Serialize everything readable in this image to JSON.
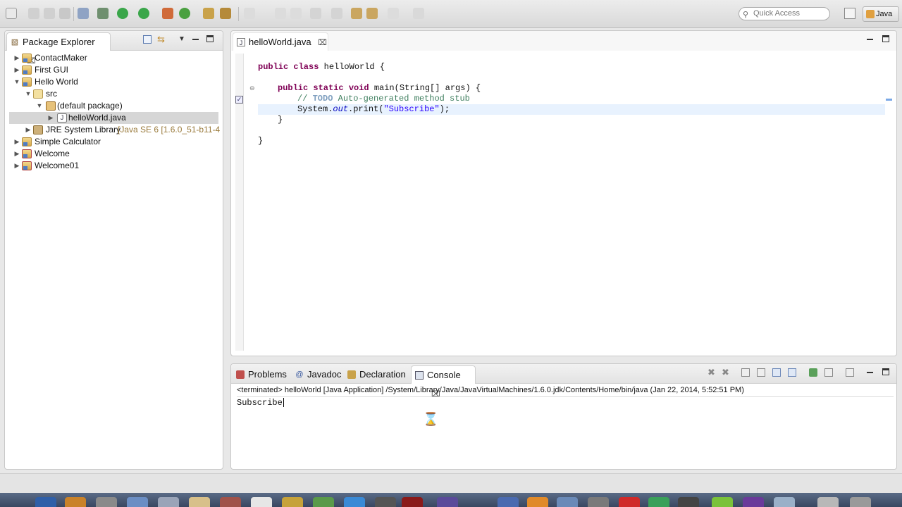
{
  "toolbar": {
    "quick_access_placeholder": "Quick Access",
    "perspective_label": "Java"
  },
  "package_explorer": {
    "title": "Package Explorer",
    "tree": [
      {
        "label": "ContactMaker",
        "icon": "project-icon",
        "expanded": false
      },
      {
        "label": "First GUI",
        "icon": "project-icon",
        "expanded": false
      },
      {
        "label": "Hello World",
        "icon": "project-icon",
        "expanded": true
      },
      {
        "label": "src",
        "icon": "source-folder-icon",
        "expanded": true
      },
      {
        "label": "(default package)",
        "icon": "package-icon",
        "expanded": true
      },
      {
        "label": "helloWorld.java",
        "icon": "java-file-icon",
        "selected": true
      },
      {
        "label": "JRE System Library",
        "decoration": "[Java SE 6 [1.6.0_51-b11-4",
        "icon": "library-icon"
      },
      {
        "label": "Simple Calculator",
        "icon": "project-icon",
        "expanded": false
      },
      {
        "label": "Welcome",
        "icon": "project-icon",
        "expanded": false
      },
      {
        "label": "Welcome01",
        "icon": "project-icon",
        "expanded": false
      }
    ]
  },
  "editor": {
    "tab_label": "helloWorld.java",
    "lines": {
      "l1_kw": "public class",
      "l1_rest": " helloWorld {",
      "l3_kw": "public static void",
      "l3_rest": " main(String[] args) {",
      "l4_comment_a": "// ",
      "l4_todo": "TODO",
      "l4_comment_b": " Auto-generated method stub",
      "l5_a": "System.",
      "l5_out": "out",
      "l5_b": ".print(",
      "l5_str": "\"Subscribe\"",
      "l5_c": ");",
      "l6": "}",
      "l8": "}"
    }
  },
  "bottom_panel": {
    "tabs": {
      "problems": "Problems",
      "javadoc": "Javadoc",
      "declaration": "Declaration",
      "console": "Console"
    },
    "console_header": "<terminated> helloWorld [Java Application] /System/Library/Java/JavaVirtualMachines/1.6.0.jdk/Contents/Home/bin/java (Jan 22, 2014, 5:52:51 PM)",
    "console_output": "Subscribe"
  }
}
